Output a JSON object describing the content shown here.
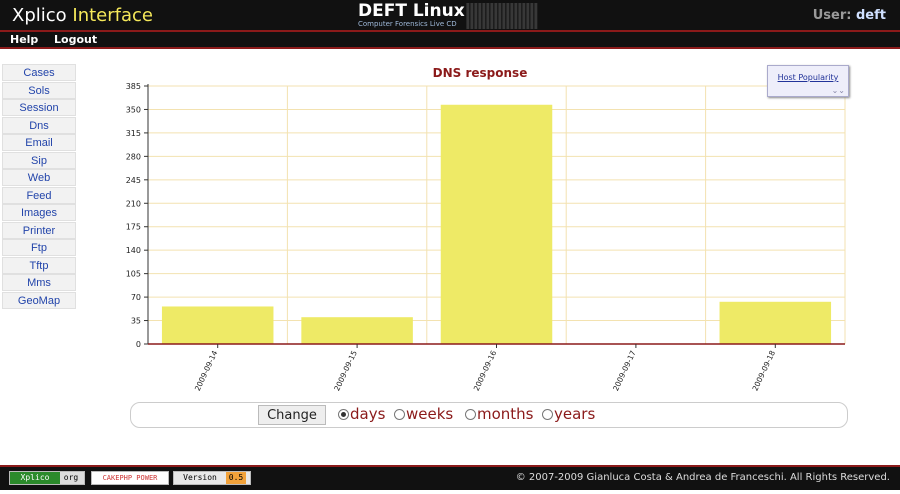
{
  "header": {
    "logo_part1": "Xplico ",
    "logo_part2": "Interface",
    "deft_title": "DEFT Linux",
    "deft_subtitle": "Computer Forensics Live CD",
    "user_label": "User:",
    "user_name": "deft"
  },
  "menu": {
    "help": "Help",
    "logout": "Logout"
  },
  "sidebar": {
    "items": [
      "Cases",
      "Sols",
      "Session",
      "Dns",
      "Email",
      "Sip",
      "Web",
      "Feed",
      "Images",
      "Printer",
      "Ftp",
      "Tftp",
      "Mms",
      "GeoMap"
    ]
  },
  "host_popularity_label": "Host Popularity",
  "chart_data": {
    "type": "bar",
    "title": "DNS response",
    "categories": [
      "2009-09-14",
      "2009-09-15",
      "2009-09-16",
      "2009-09-17",
      "2009-09-18"
    ],
    "values": [
      56,
      40,
      357,
      0,
      63
    ],
    "yticks": [
      0,
      35,
      70,
      105,
      140,
      175,
      210,
      245,
      280,
      315,
      350,
      385
    ],
    "ylim": [
      0,
      385
    ],
    "bar_color": "#eeea66",
    "grid": true
  },
  "controls": {
    "change_label": "Change",
    "options": [
      {
        "label": "days",
        "selected": true
      },
      {
        "label": "weeks",
        "selected": false
      },
      {
        "label": "months",
        "selected": false
      },
      {
        "label": "years",
        "selected": false
      }
    ]
  },
  "footer": {
    "xplico_badge": "Xplico",
    "xplico_badge_ext": "org",
    "cake_badge": "CAKEPHP POWER",
    "version_label": "Version",
    "version_number": "0.5",
    "copyright": "© 2007-2009 Gianluca Costa & Andrea de Franceschi. All Rights Reserved."
  }
}
